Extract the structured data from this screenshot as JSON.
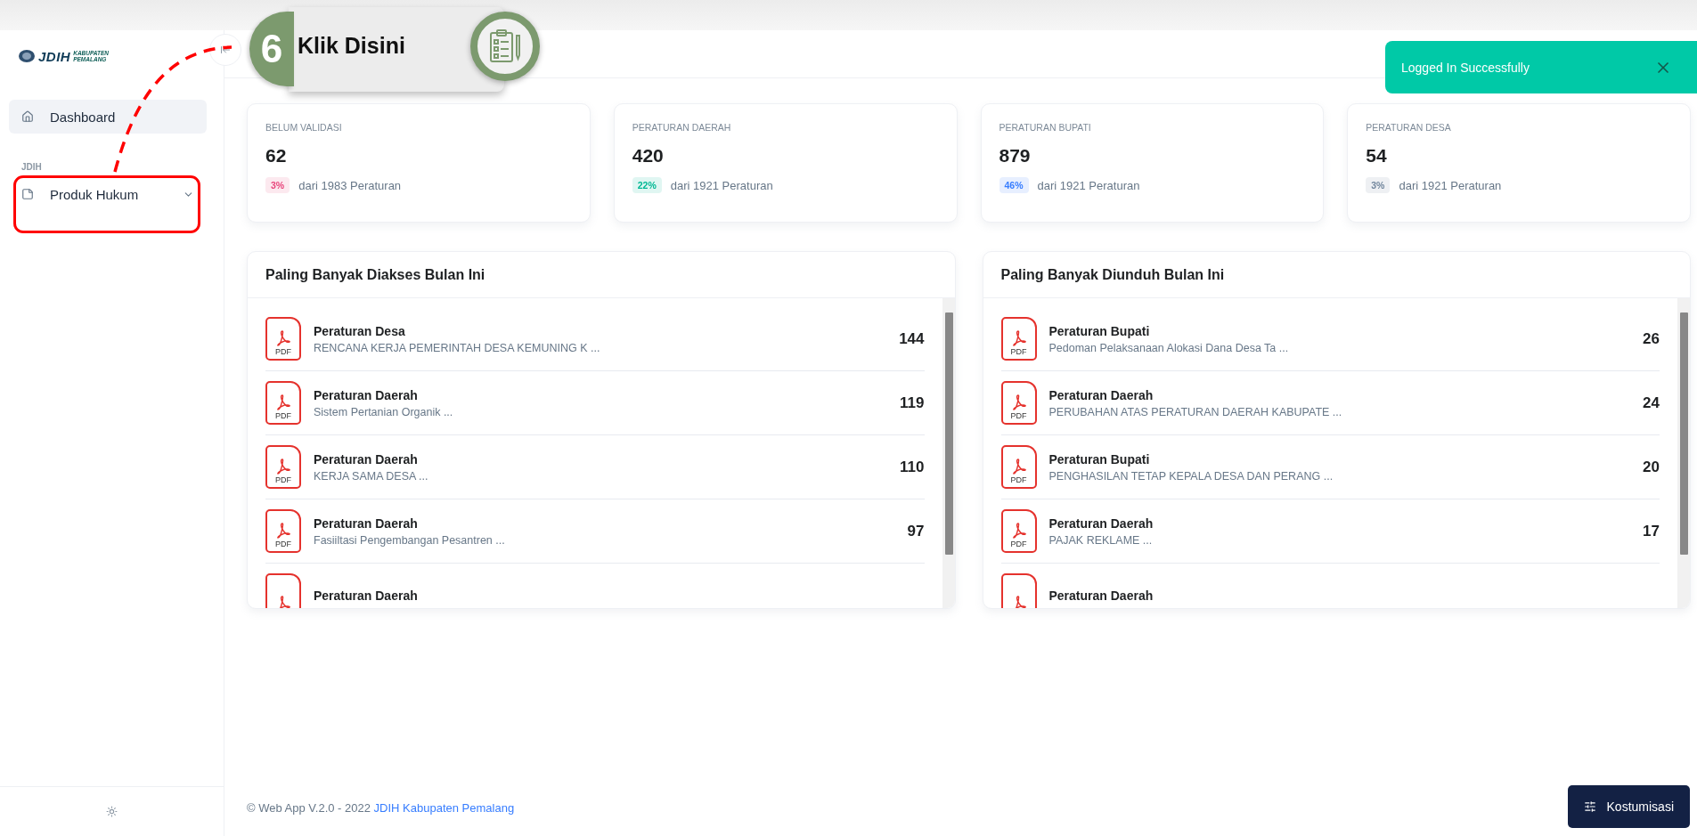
{
  "logo": {
    "title": "JDIH",
    "line_1": "KABUPATEN",
    "line_2": "PEMALANG"
  },
  "sidebar": {
    "items": [
      {
        "kind": "home",
        "label": "Dashboard",
        "selected": true
      },
      {
        "kind": "heading",
        "label": "JDIH"
      },
      {
        "kind": "group",
        "label": "Produk Hukum",
        "selected": false
      }
    ]
  },
  "tutorial": {
    "step": "6",
    "label": "Klik Disini"
  },
  "toast": {
    "message": "Logged In Successfully"
  },
  "stats": [
    {
      "label": "BELUM VALIDASI",
      "value": "62",
      "percent": "3%",
      "color": "#e8467c",
      "note": "dari 1983 Peraturan"
    },
    {
      "label": "PERATURAN DAERAH",
      "value": "420",
      "percent": "22%",
      "color": "#00b894",
      "note": "dari 1921 Peraturan"
    },
    {
      "label": "PERATURAN BUPATI",
      "value": "879",
      "percent": "46%",
      "color": "#377dff",
      "note": "dari 1921 Peraturan"
    },
    {
      "label": "PERATURAN DESA",
      "value": "54",
      "percent": "3%",
      "color": "#71869d",
      "note": "dari 1921 Peraturan"
    }
  ],
  "panels": [
    {
      "title": "Paling Banyak Diakses Bulan Ini",
      "rows": [
        {
          "file": "PDF",
          "type": "Peraturan Desa",
          "title": "RENCANA KERJA PEMERINTAH DESA KEMUNING K ...",
          "count": "144"
        },
        {
          "file": "PDF",
          "type": "Peraturan Daerah",
          "title": "Sistem Pertanian Organik ...",
          "count": "119"
        },
        {
          "file": "PDF",
          "type": "Peraturan Daerah",
          "title": "KERJA SAMA DESA ...",
          "count": "110"
        },
        {
          "file": "PDF",
          "type": "Peraturan Daerah",
          "title": "Fasiiltasi Pengembangan Pesantren ...",
          "count": "97"
        },
        {
          "type": "Peraturan Daerah"
        }
      ]
    },
    {
      "title": "Paling Banyak Diunduh Bulan Ini",
      "rows": [
        {
          "file": "PDF",
          "type": "Peraturan Bupati",
          "title": "Pedoman Pelaksanaan Alokasi Dana Desa Ta ...",
          "count": "26"
        },
        {
          "file": "PDF",
          "type": "Peraturan Daerah",
          "title": "PERUBAHAN ATAS PERATURAN DAERAH KABUPATE ...",
          "count": "24"
        },
        {
          "file": "PDF",
          "type": "Peraturan Bupati",
          "title": "PENGHASILAN TETAP KEPALA DESA DAN PERANG ...",
          "count": "20"
        },
        {
          "file": "PDF",
          "type": "Peraturan Daerah",
          "title": "PAJAK REKLAME ...",
          "count": "17"
        },
        {
          "type": "Peraturan Daerah"
        }
      ]
    }
  ],
  "footer": {
    "text": "© Web App V.2.0 - 2022",
    "link": "JDIH Kabupaten Pemalang"
  },
  "customize_button": "Kostumisasi"
}
